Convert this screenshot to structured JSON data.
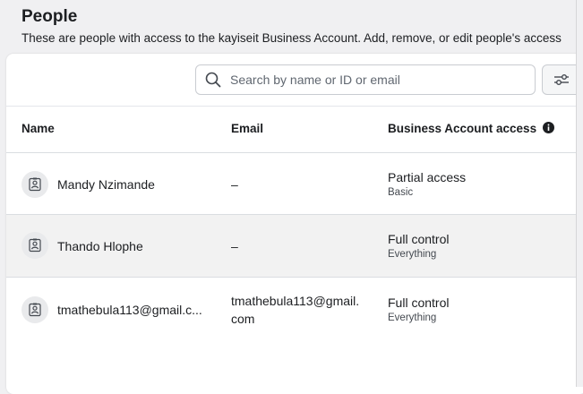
{
  "header": {
    "title": "People",
    "description": "These are people with access to the kayiseit Business Account. Add, remove, or edit people's access"
  },
  "search": {
    "placeholder": "Search by name or ID or email",
    "value": ""
  },
  "icons": {
    "search": "search-icon",
    "filter": "filter-sliders-icon",
    "info": "info-icon",
    "avatar": "person-badge-icon"
  },
  "table": {
    "columns": {
      "name": "Name",
      "email": "Email",
      "access": "Business Account access"
    },
    "rows": [
      {
        "name": "Mandy Nzimande",
        "email": "–",
        "access": "Partial access",
        "access_detail": "Basic"
      },
      {
        "name": "Thando Hlophe",
        "email": "–",
        "access": "Full control",
        "access_detail": "Everything"
      },
      {
        "name": "tmathebula113@gmail.c...",
        "email": "tmathebula113@gmail.com",
        "access": "Full control",
        "access_detail": "Everything"
      }
    ]
  }
}
